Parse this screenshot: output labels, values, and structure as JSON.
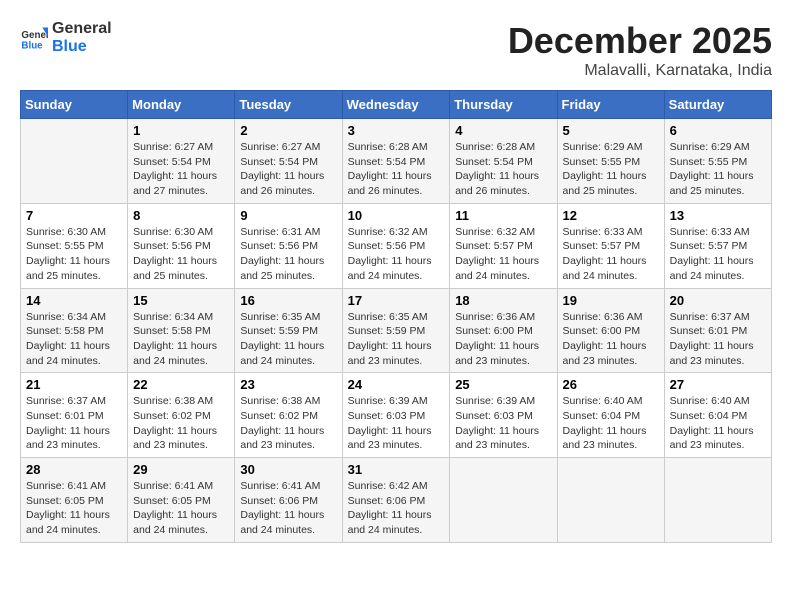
{
  "logo": {
    "line1": "General",
    "line2": "Blue"
  },
  "title": "December 2025",
  "location": "Malavalli, Karnataka, India",
  "weekdays": [
    "Sunday",
    "Monday",
    "Tuesday",
    "Wednesday",
    "Thursday",
    "Friday",
    "Saturday"
  ],
  "weeks": [
    [
      {
        "day": "",
        "info": ""
      },
      {
        "day": "1",
        "info": "Sunrise: 6:27 AM\nSunset: 5:54 PM\nDaylight: 11 hours\nand 27 minutes."
      },
      {
        "day": "2",
        "info": "Sunrise: 6:27 AM\nSunset: 5:54 PM\nDaylight: 11 hours\nand 26 minutes."
      },
      {
        "day": "3",
        "info": "Sunrise: 6:28 AM\nSunset: 5:54 PM\nDaylight: 11 hours\nand 26 minutes."
      },
      {
        "day": "4",
        "info": "Sunrise: 6:28 AM\nSunset: 5:54 PM\nDaylight: 11 hours\nand 26 minutes."
      },
      {
        "day": "5",
        "info": "Sunrise: 6:29 AM\nSunset: 5:55 PM\nDaylight: 11 hours\nand 25 minutes."
      },
      {
        "day": "6",
        "info": "Sunrise: 6:29 AM\nSunset: 5:55 PM\nDaylight: 11 hours\nand 25 minutes."
      }
    ],
    [
      {
        "day": "7",
        "info": "Sunrise: 6:30 AM\nSunset: 5:55 PM\nDaylight: 11 hours\nand 25 minutes."
      },
      {
        "day": "8",
        "info": "Sunrise: 6:30 AM\nSunset: 5:56 PM\nDaylight: 11 hours\nand 25 minutes."
      },
      {
        "day": "9",
        "info": "Sunrise: 6:31 AM\nSunset: 5:56 PM\nDaylight: 11 hours\nand 25 minutes."
      },
      {
        "day": "10",
        "info": "Sunrise: 6:32 AM\nSunset: 5:56 PM\nDaylight: 11 hours\nand 24 minutes."
      },
      {
        "day": "11",
        "info": "Sunrise: 6:32 AM\nSunset: 5:57 PM\nDaylight: 11 hours\nand 24 minutes."
      },
      {
        "day": "12",
        "info": "Sunrise: 6:33 AM\nSunset: 5:57 PM\nDaylight: 11 hours\nand 24 minutes."
      },
      {
        "day": "13",
        "info": "Sunrise: 6:33 AM\nSunset: 5:57 PM\nDaylight: 11 hours\nand 24 minutes."
      }
    ],
    [
      {
        "day": "14",
        "info": "Sunrise: 6:34 AM\nSunset: 5:58 PM\nDaylight: 11 hours\nand 24 minutes."
      },
      {
        "day": "15",
        "info": "Sunrise: 6:34 AM\nSunset: 5:58 PM\nDaylight: 11 hours\nand 24 minutes."
      },
      {
        "day": "16",
        "info": "Sunrise: 6:35 AM\nSunset: 5:59 PM\nDaylight: 11 hours\nand 24 minutes."
      },
      {
        "day": "17",
        "info": "Sunrise: 6:35 AM\nSunset: 5:59 PM\nDaylight: 11 hours\nand 23 minutes."
      },
      {
        "day": "18",
        "info": "Sunrise: 6:36 AM\nSunset: 6:00 PM\nDaylight: 11 hours\nand 23 minutes."
      },
      {
        "day": "19",
        "info": "Sunrise: 6:36 AM\nSunset: 6:00 PM\nDaylight: 11 hours\nand 23 minutes."
      },
      {
        "day": "20",
        "info": "Sunrise: 6:37 AM\nSunset: 6:01 PM\nDaylight: 11 hours\nand 23 minutes."
      }
    ],
    [
      {
        "day": "21",
        "info": "Sunrise: 6:37 AM\nSunset: 6:01 PM\nDaylight: 11 hours\nand 23 minutes."
      },
      {
        "day": "22",
        "info": "Sunrise: 6:38 AM\nSunset: 6:02 PM\nDaylight: 11 hours\nand 23 minutes."
      },
      {
        "day": "23",
        "info": "Sunrise: 6:38 AM\nSunset: 6:02 PM\nDaylight: 11 hours\nand 23 minutes."
      },
      {
        "day": "24",
        "info": "Sunrise: 6:39 AM\nSunset: 6:03 PM\nDaylight: 11 hours\nand 23 minutes."
      },
      {
        "day": "25",
        "info": "Sunrise: 6:39 AM\nSunset: 6:03 PM\nDaylight: 11 hours\nand 23 minutes."
      },
      {
        "day": "26",
        "info": "Sunrise: 6:40 AM\nSunset: 6:04 PM\nDaylight: 11 hours\nand 23 minutes."
      },
      {
        "day": "27",
        "info": "Sunrise: 6:40 AM\nSunset: 6:04 PM\nDaylight: 11 hours\nand 23 minutes."
      }
    ],
    [
      {
        "day": "28",
        "info": "Sunrise: 6:41 AM\nSunset: 6:05 PM\nDaylight: 11 hours\nand 24 minutes."
      },
      {
        "day": "29",
        "info": "Sunrise: 6:41 AM\nSunset: 6:05 PM\nDaylight: 11 hours\nand 24 minutes."
      },
      {
        "day": "30",
        "info": "Sunrise: 6:41 AM\nSunset: 6:06 PM\nDaylight: 11 hours\nand 24 minutes."
      },
      {
        "day": "31",
        "info": "Sunrise: 6:42 AM\nSunset: 6:06 PM\nDaylight: 11 hours\nand 24 minutes."
      },
      {
        "day": "",
        "info": ""
      },
      {
        "day": "",
        "info": ""
      },
      {
        "day": "",
        "info": ""
      }
    ]
  ]
}
